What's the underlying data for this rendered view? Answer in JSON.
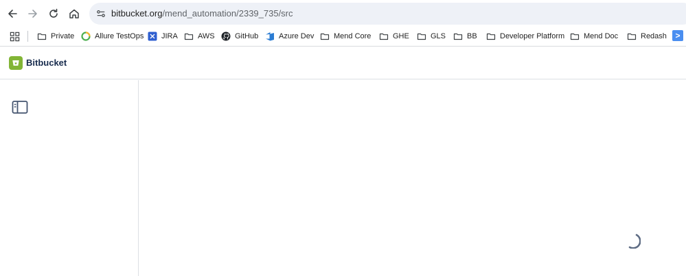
{
  "browser": {
    "url_host": "bitbucket.org",
    "url_path": "/mend_automation/2339_735/src"
  },
  "bookmarks": [
    {
      "label": "Private",
      "icon": "folder-icon"
    },
    {
      "label": "Allure TestOps",
      "icon": "allure-icon"
    },
    {
      "label": "JIRA",
      "icon": "jira-icon"
    },
    {
      "label": "AWS",
      "icon": "folder-icon"
    },
    {
      "label": "GitHub",
      "icon": "github-icon"
    },
    {
      "label": "Azure Dev",
      "icon": "azure-devops-icon"
    },
    {
      "label": "Mend Core",
      "icon": "folder-icon"
    },
    {
      "label": "GHE",
      "icon": "folder-icon"
    },
    {
      "label": "GLS",
      "icon": "folder-icon"
    },
    {
      "label": "BB",
      "icon": "folder-icon"
    },
    {
      "label": "Developer Platform",
      "icon": "folder-icon"
    },
    {
      "label": "Mend Doc",
      "icon": "folder-icon"
    },
    {
      "label": "Redash",
      "icon": "folder-icon"
    }
  ],
  "bookmarks_overflow": ">",
  "app": {
    "brand": "Bitbucket",
    "brand_color": "#82b536"
  },
  "main": {
    "state": "loading"
  }
}
